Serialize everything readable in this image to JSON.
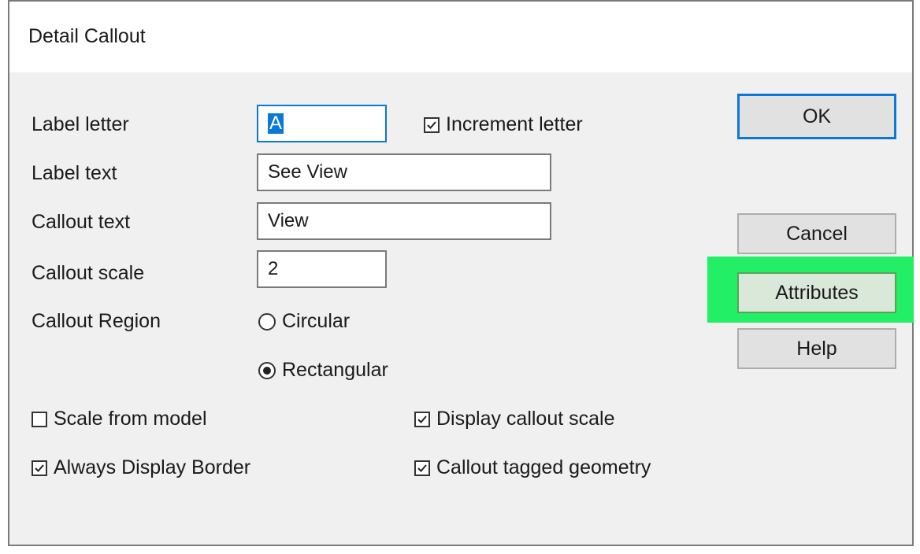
{
  "dialog": {
    "title": "Detail Callout",
    "fields": {
      "label_letter": {
        "label": "Label letter",
        "value": "A"
      },
      "label_text": {
        "label": "Label text",
        "value": "See View"
      },
      "callout_text": {
        "label": "Callout text",
        "value": "View"
      },
      "callout_scale": {
        "label": "Callout scale",
        "value": "2"
      }
    },
    "increment_letter": {
      "label": "Increment letter",
      "checked": true
    },
    "callout_region": {
      "label": "Callout Region",
      "options": [
        {
          "label": "Circular",
          "selected": false
        },
        {
          "label": "Rectangular",
          "selected": true
        }
      ]
    },
    "checkboxes": {
      "scale_from_model": {
        "label": "Scale from model",
        "checked": false
      },
      "display_callout_scale": {
        "label": "Display callout scale",
        "checked": true
      },
      "always_display_border": {
        "label": "Always Display Border",
        "checked": true
      },
      "callout_tagged_geometry": {
        "label": "Callout tagged geometry",
        "checked": true
      }
    },
    "buttons": {
      "ok": "OK",
      "cancel": "Cancel",
      "attributes": "Attributes",
      "help": "Help"
    },
    "highlight_color": "#22ee66",
    "accent_color": "#0a78d7"
  }
}
